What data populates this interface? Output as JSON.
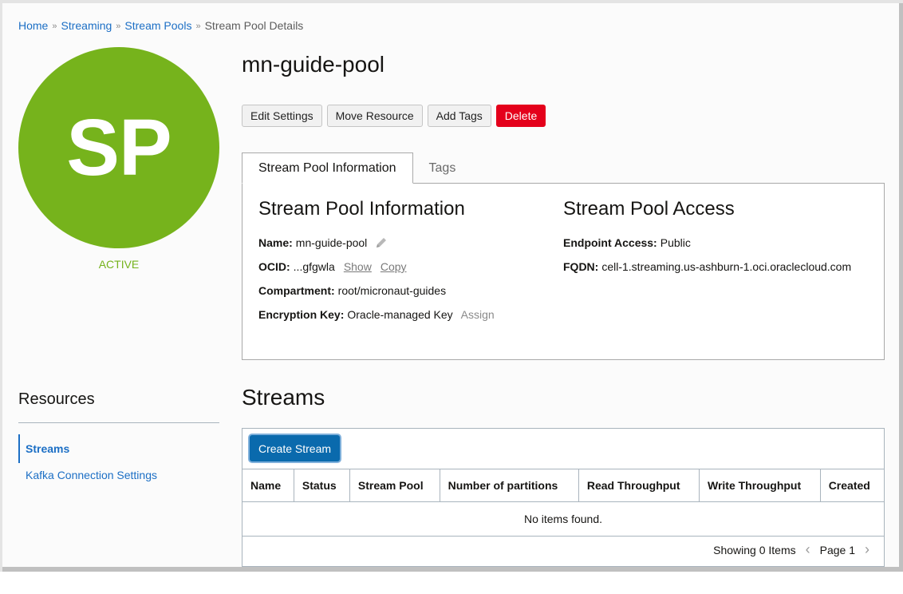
{
  "breadcrumb": {
    "items": [
      "Home",
      "Streaming",
      "Stream Pools"
    ],
    "current": "Stream Pool Details",
    "separator": "»"
  },
  "avatar": {
    "initials": "SP",
    "color": "#76b31c"
  },
  "status": {
    "label": "ACTIVE",
    "color": "#76b31c"
  },
  "page_title": "mn-guide-pool",
  "actions": {
    "edit": "Edit Settings",
    "move": "Move Resource",
    "add_tags": "Add Tags",
    "delete": "Delete"
  },
  "tabs": [
    "Stream Pool Information",
    "Tags"
  ],
  "info": {
    "left_heading": "Stream Pool Information",
    "name_label": "Name:",
    "name_value": "mn-guide-pool",
    "ocid_label": "OCID:",
    "ocid_value": "...gfgwla",
    "ocid_show": "Show",
    "ocid_copy": "Copy",
    "compartment_label": "Compartment:",
    "compartment_value": "root/micronaut-guides",
    "encryption_label": "Encryption Key:",
    "encryption_value": "Oracle-managed Key",
    "encryption_assign": "Assign",
    "right_heading": "Stream Pool Access",
    "endpoint_label": "Endpoint Access:",
    "endpoint_value": "Public",
    "fqdn_label": "FQDN:",
    "fqdn_value": "cell-1.streaming.us-ashburn-1.oci.oraclecloud.com"
  },
  "resources": {
    "title": "Resources",
    "items": [
      "Streams",
      "Kafka Connection Settings"
    ]
  },
  "streams": {
    "title": "Streams",
    "create_button": "Create Stream",
    "columns": [
      "Name",
      "Status",
      "Stream Pool",
      "Number of partitions",
      "Read Throughput",
      "Write Throughput",
      "Created"
    ],
    "empty_message": "No items found.",
    "showing": "Showing 0 Items",
    "page": "Page 1",
    "prev_icon": "‹",
    "next_icon": "›"
  }
}
